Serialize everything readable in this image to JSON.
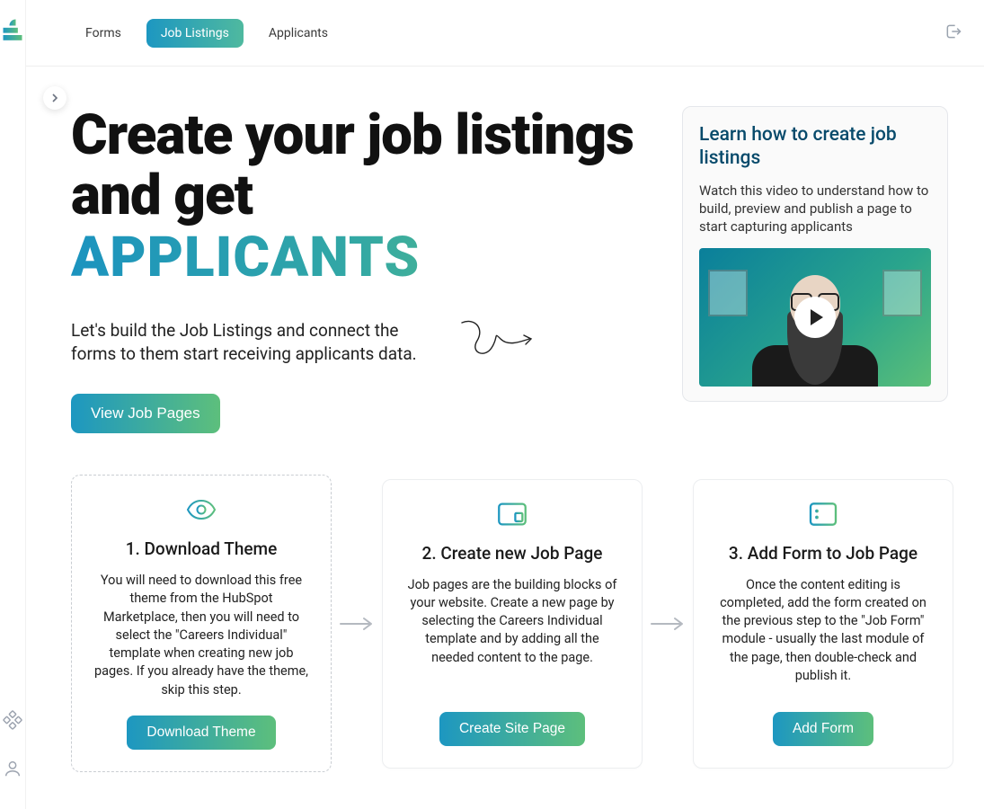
{
  "nav": {
    "tabs": [
      {
        "label": "Forms",
        "active": false
      },
      {
        "label": "Job Listings",
        "active": true
      },
      {
        "label": "Applicants",
        "active": false
      }
    ]
  },
  "hero": {
    "title_plain": "Create your job listings and get",
    "title_highlight": "APPLICANTS",
    "subtitle": "Let's build the Job Listings and connect the forms to them start receiving applicants data.",
    "cta_label": "View Job Pages"
  },
  "info": {
    "title": "Learn how to create job listings",
    "text": "Watch this video to understand how to build, preview and publish a page to start capturing applicants"
  },
  "steps": [
    {
      "title": "1. Download Theme",
      "text": "You will need to download this free theme from the HubSpot Marketplace, then you will need to select the \"Careers Individual\" template when creating new job pages. If you already have the theme, skip this step.",
      "button": "Download Theme"
    },
    {
      "title": "2. Create new Job Page",
      "text": "Job pages are the building blocks of your website. Create a new page by selecting the Careers Individual template and by adding all the needed content to the page.",
      "button": "Create Site Page"
    },
    {
      "title": "3. Add Form to Job Page",
      "text": "Once the content editing is completed, add the form created on the previous step to the \"Job Form\" module - usually the last module of the page, then double-check and publish it.",
      "button": "Add Form"
    }
  ]
}
